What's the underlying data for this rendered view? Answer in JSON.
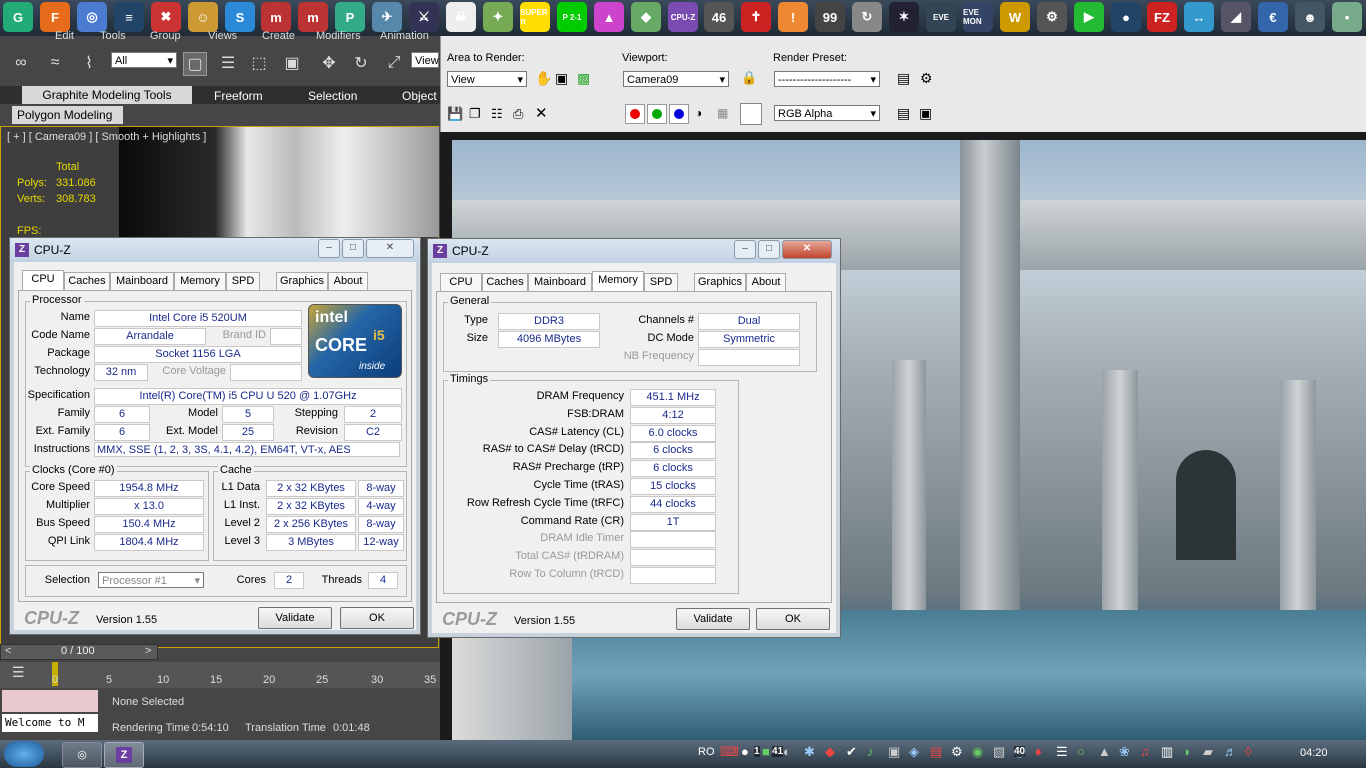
{
  "launcher": {
    "icons": [
      "G",
      "F",
      "◎",
      "≡",
      "✖",
      "☺",
      "S",
      "m",
      "m",
      "P",
      "✈",
      "⚔",
      "☠",
      "✦",
      "SUPER π",
      "P 2-1",
      "▲",
      "◆",
      "CPU-Z",
      "46",
      "✝",
      "!",
      "99",
      "↻",
      "✶",
      "EVE",
      "EVE MON",
      "W",
      "⚙",
      "▶",
      "●",
      "FZ",
      "↔",
      "◢",
      "€",
      "☻",
      "•"
    ],
    "colors": [
      "#2a7",
      "#e66b1a",
      "#4a7bd0",
      "#246",
      "#c33",
      "#c93",
      "#2a8ad8",
      "#b33",
      "#b33",
      "#3a8",
      "#58a",
      "#335",
      "#eee",
      "#7a5",
      "#fd0",
      "#0c0",
      "#c4c",
      "#6a6",
      "#7a4bb0",
      "#555",
      "#c22",
      "#e83",
      "#444",
      "#888",
      "#223",
      "#345",
      "#346",
      "#c90",
      "#555",
      "#2b3",
      "#246",
      "#c22",
      "#39c",
      "#556",
      "#36a",
      "#456",
      "#7a8"
    ]
  },
  "max": {
    "menu": [
      "Edit",
      "Tools",
      "Group",
      "Views",
      "Create",
      "Modifiers",
      "Animation"
    ],
    "selection_filter": "All",
    "view_label": "View",
    "ribbon_tabs": [
      "Graphite Modeling Tools",
      "Freeform",
      "Selection",
      "Object"
    ],
    "ribbon_subtab": "Polygon Modeling",
    "viewport_label": "[ + ] [ Camera09 ] [ Smooth + Highlights ]",
    "stats_total": "Total",
    "polys_label": "Polys:",
    "polys_value": "331.086",
    "verts_label": "Verts:",
    "verts_value": "308.783",
    "fps_label": "FPS:",
    "frame_counter": "0 / 100",
    "timeline_ticks": [
      "0",
      "5",
      "10",
      "15",
      "20",
      "25",
      "30",
      "35"
    ],
    "selection_status": "None Selected",
    "maxscript_text": "Welcome to M",
    "rendering_time_label": "Rendering Time",
    "rendering_time": "0:54:10",
    "translation_time_label": "Translation Time",
    "translation_time": "0:01:48"
  },
  "render": {
    "area_label": "Area to Render:",
    "area_value": "View",
    "viewport_label": "Viewport:",
    "viewport_value": "Camera09",
    "preset_label": "Render Preset:",
    "preset_value": "--------------------",
    "channel_value": "RGB Alpha"
  },
  "cpuz_cpu": {
    "title": "CPU-Z",
    "tabs": [
      "CPU",
      "Caches",
      "Mainboard",
      "Memory",
      "SPD",
      "Graphics",
      "About"
    ],
    "processor_group": "Processor",
    "name_label": "Name",
    "name": "Intel Core i5 520UM",
    "codename_label": "Code Name",
    "codename": "Arrandale",
    "brandid_label": "Brand ID",
    "package_label": "Package",
    "package": "Socket 1156 LGA",
    "technology_label": "Technology",
    "technology": "32 nm",
    "voltage_label": "Core Voltage",
    "spec_label": "Specification",
    "spec": "Intel(R) Core(TM) i5 CPU     U 520  @ 1.07GHz",
    "family_label": "Family",
    "family": "6",
    "model_label": "Model",
    "model": "5",
    "stepping_label": "Stepping",
    "stepping": "2",
    "extfamily_label": "Ext. Family",
    "extfamily": "6",
    "extmodel_label": "Ext. Model",
    "extmodel": "25",
    "revision_label": "Revision",
    "revision": "C2",
    "instructions_label": "Instructions",
    "instructions": "MMX, SSE (1, 2, 3, 3S, 4.1, 4.2), EM64T, VT-x, AES",
    "logo_top": "intel",
    "logo_mid": "CORE",
    "logo_i5": "i5",
    "logo_bottom": "inside",
    "clocks_group": "Clocks (Core #0)",
    "corespeed_label": "Core Speed",
    "corespeed": "1954.8 MHz",
    "multiplier_label": "Multiplier",
    "multiplier": "x 13.0",
    "busspeed_label": "Bus Speed",
    "busspeed": "150.4 MHz",
    "qpi_label": "QPI Link",
    "qpi": "1804.4 MHz",
    "cache_group": "Cache",
    "l1d_label": "L1 Data",
    "l1d": "2 x 32 KBytes",
    "l1d_way": "8-way",
    "l1i_label": "L1 Inst.",
    "l1i": "2 x 32 KBytes",
    "l1i_way": "4-way",
    "l2_label": "Level 2",
    "l2": "2 x 256 KBytes",
    "l2_way": "8-way",
    "l3_label": "Level 3",
    "l3": "3 MBytes",
    "l3_way": "12-way",
    "selection_label": "Selection",
    "selection": "Processor #1",
    "cores_label": "Cores",
    "cores": "2",
    "threads_label": "Threads",
    "threads": "4",
    "brand": "CPU-Z",
    "version": "Version 1.55",
    "validate": "Validate",
    "ok": "OK"
  },
  "cpuz_mem": {
    "title": "CPU-Z",
    "tabs": [
      "CPU",
      "Caches",
      "Mainboard",
      "Memory",
      "SPD",
      "Graphics",
      "About"
    ],
    "general_group": "General",
    "type_label": "Type",
    "type": "DDR3",
    "size_label": "Size",
    "size": "4096 MBytes",
    "channels_label": "Channels #",
    "channels": "Dual",
    "dcmode_label": "DC Mode",
    "dcmode": "Symmetric",
    "nbfreq_label": "NB Frequency",
    "timings_group": "Timings",
    "timings": [
      {
        "label": "DRAM Frequency",
        "value": "451.1 MHz",
        "enabled": true
      },
      {
        "label": "FSB:DRAM",
        "value": "4:12",
        "enabled": true
      },
      {
        "label": "CAS# Latency (CL)",
        "value": "6.0 clocks",
        "enabled": true
      },
      {
        "label": "RAS# to CAS# Delay (tRCD)",
        "value": "6 clocks",
        "enabled": true
      },
      {
        "label": "RAS# Precharge (tRP)",
        "value": "6 clocks",
        "enabled": true
      },
      {
        "label": "Cycle Time (tRAS)",
        "value": "15 clocks",
        "enabled": true
      },
      {
        "label": "Row Refresh Cycle Time (tRFC)",
        "value": "44 clocks",
        "enabled": true
      },
      {
        "label": "Command Rate (CR)",
        "value": "1T",
        "enabled": true
      },
      {
        "label": "DRAM Idle Timer",
        "value": "",
        "enabled": false
      },
      {
        "label": "Total CAS# (tRDRAM)",
        "value": "",
        "enabled": false
      },
      {
        "label": "Row To Column (tRCD)",
        "value": "",
        "enabled": false
      }
    ],
    "brand": "CPU-Z",
    "version": "Version 1.55",
    "validate": "Validate",
    "ok": "OK"
  },
  "taskbar": {
    "lang": "RO",
    "clock": "04:20",
    "tray_numbers": [
      "1",
      "41",
      "40"
    ]
  }
}
